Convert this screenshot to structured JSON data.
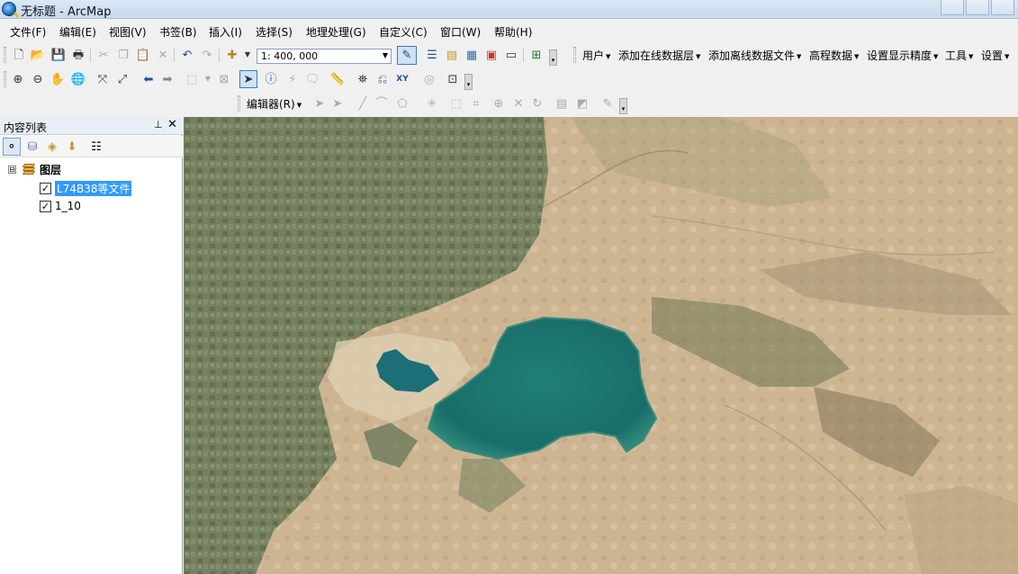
{
  "window": {
    "title": "无标题 - ArcMap"
  },
  "menu": [
    {
      "label": "文件(F)"
    },
    {
      "label": "编辑(E)"
    },
    {
      "label": "视图(V)"
    },
    {
      "label": "书签(B)"
    },
    {
      "label": "插入(I)"
    },
    {
      "label": "选择(S)"
    },
    {
      "label": "地理处理(G)"
    },
    {
      "label": "自定义(C)"
    },
    {
      "label": "窗口(W)"
    },
    {
      "label": "帮助(H)"
    }
  ],
  "standard_toolbar": {
    "scale_value": "1: 400, 000"
  },
  "plugin_toolbar": {
    "items": [
      {
        "label": "用户"
      },
      {
        "label": "添加在线数据层"
      },
      {
        "label": "添加离线数据文件"
      },
      {
        "label": "高程数据"
      },
      {
        "label": "设置显示精度"
      },
      {
        "label": "工具"
      },
      {
        "label": "设置"
      }
    ]
  },
  "editor_toolbar": {
    "label": "编辑器(R)"
  },
  "toc": {
    "title": "内容列表",
    "pin_glyph": "⊥",
    "close_glyph": "✕",
    "root": {
      "label": "图层",
      "expander": "⊟"
    },
    "layers": [
      {
        "label": "L74B38等文件",
        "checked": true,
        "selected": true
      },
      {
        "label": "1_10",
        "checked": true,
        "selected": false
      }
    ]
  },
  "icons": {
    "app": "arcmap-globe-icon",
    "check_glyph": "✓"
  },
  "colors": {
    "selection": "#3399ff",
    "lake": "#1f7d78",
    "desert": "#cdb592",
    "farmland": "#6b7a5a"
  }
}
